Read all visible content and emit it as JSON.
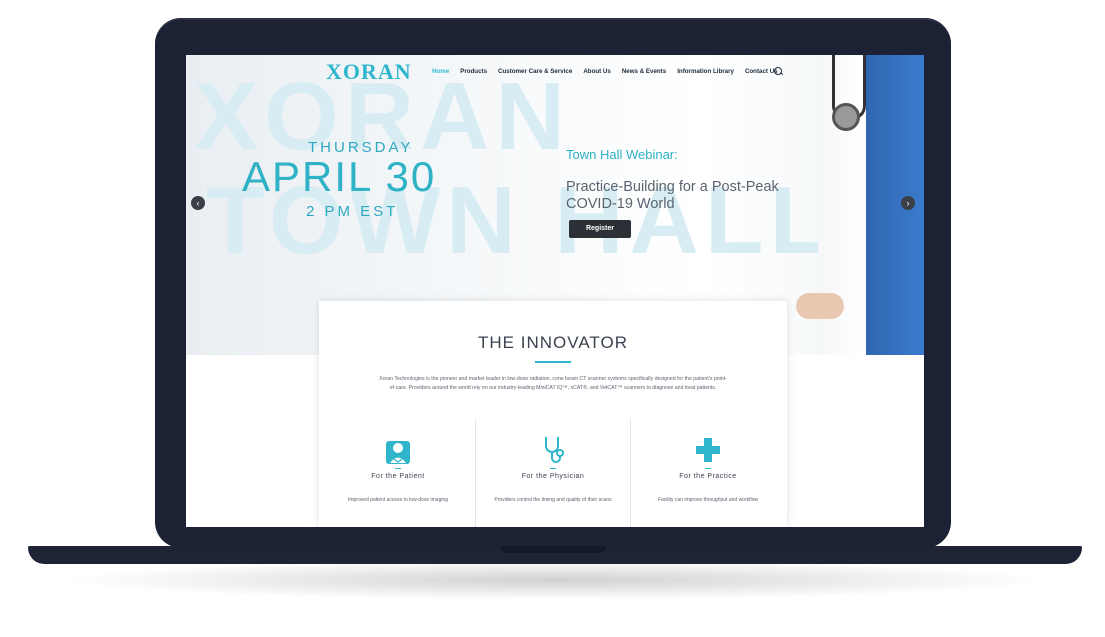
{
  "nav": {
    "logo": "XORAN",
    "items": [
      "Home",
      "Products",
      "Customer Care & Service",
      "About Us",
      "News & Events",
      "Information Library",
      "Contact Us"
    ],
    "active": "Home"
  },
  "hero": {
    "bg_word_1": "XORAN",
    "bg_word_2": "TOWN HALL",
    "day": "THURSDAY",
    "date": "APRIL 30",
    "time": "2 PM EST",
    "webinar_label": "Town Hall Webinar:",
    "webinar_title": "Practice-Building for a Post-Peak COVID-19 World",
    "register_label": "Register",
    "prev_arrow": "‹",
    "next_arrow": "›"
  },
  "innovator": {
    "title": "THE INNOVATOR",
    "description": "Xoran Technologies is the pioneer and market leader in low-dose radiation, cone beam CT scanner systems specifically designed for the patient's point-of-care. Providers around the world rely on our industry-leading MiniCAT IQ™, xCAT®, and VetCAT™ scanners to diagnose and treat patients.",
    "columns": [
      {
        "title": "For the Patient",
        "icon": "patient-icon",
        "desc": "Improved patient access to low-dose imaging"
      },
      {
        "title": "For the Physician",
        "icon": "stethoscope-icon",
        "desc": "Providers control the timing and quality of their scans"
      },
      {
        "title": "For the Practice",
        "icon": "medical-cross-icon",
        "desc": "Facility can improve throughput and workflow"
      }
    ]
  },
  "colors": {
    "accent": "#2fb6cc",
    "laptop": "#1c2233",
    "button": "#2b2f36"
  }
}
